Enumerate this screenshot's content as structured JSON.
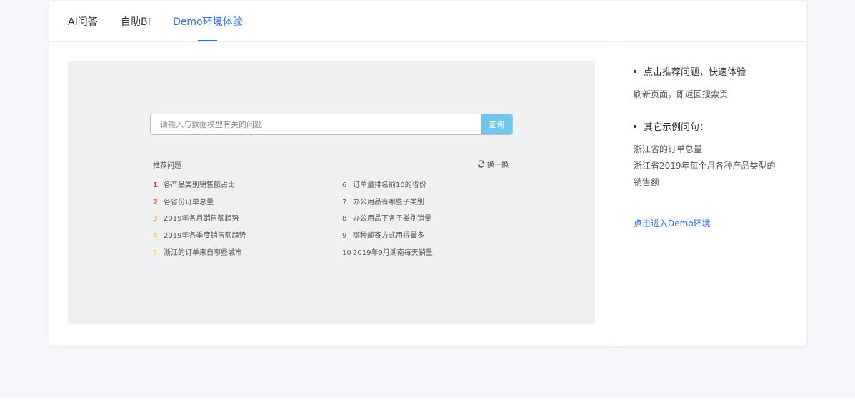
{
  "tabs": [
    {
      "label": "AI问答"
    },
    {
      "label": "自助BI"
    },
    {
      "label": "Demo环境体验"
    }
  ],
  "preview": {
    "search": {
      "placeholder": "请输入与数据模型有关的问题",
      "button_label": "查询"
    },
    "recommend_title": "推荐问题",
    "refresh_label": "换一换",
    "questions_left": [
      {
        "num": "1",
        "text": "各产品类别销售额占比"
      },
      {
        "num": "2",
        "text": "各省份订单总量"
      },
      {
        "num": "3",
        "text": "2019年各月销售额趋势"
      },
      {
        "num": "4",
        "text": "2019年各季度销售额趋势"
      },
      {
        "num": "5",
        "text": "浙江的订单来自哪些城市"
      }
    ],
    "questions_right": [
      {
        "num": "6",
        "text": "订单量排名前10的省份"
      },
      {
        "num": "7",
        "text": "办公用品有哪些子类别"
      },
      {
        "num": "8",
        "text": "办公用品下各子类别销量"
      },
      {
        "num": "9",
        "text": "哪种邮寄方式用得最多"
      },
      {
        "num": "10",
        "text": "2019年9月湖南每天销量"
      }
    ],
    "rank_colors": [
      "#f5222d",
      "#fa541c",
      "#fa8c16",
      "#faad14",
      "#fadb14"
    ]
  },
  "sidebar": {
    "bullet1": "点击推荐问题，快速体验",
    "note1": "刷新页面，即返回搜索页",
    "bullet2": "其它示例问句：",
    "examples": [
      "浙江省的订单总量",
      "浙江省2019年每个月各种产品类型的",
      "销售额"
    ],
    "demo_link": "点击进入Demo环境"
  },
  "colors": {
    "accent": "#296df1",
    "search_button": "#72c5eb",
    "preview_bg": "#eff0f2",
    "page_bg": "#f5f7fa"
  },
  "icons": [
    "refresh-icon"
  ]
}
